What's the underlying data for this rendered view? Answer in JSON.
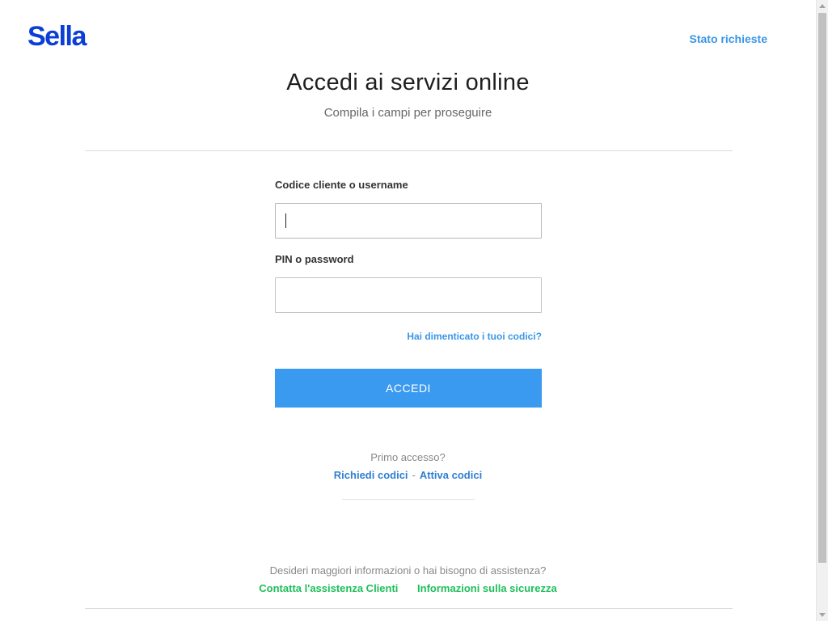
{
  "header": {
    "logo_text": "Sella",
    "status_link": "Stato richieste"
  },
  "main": {
    "title": "Accedi ai servizi online",
    "subtitle": "Compila i campi per proseguire"
  },
  "form": {
    "username_label": "Codice cliente o username",
    "username_value": "",
    "password_label": "PIN o password",
    "password_value": "",
    "forgot_link": "Hai dimenticato i tuoi codici?",
    "submit_label": "ACCEDI"
  },
  "first_access": {
    "question": "Primo accesso?",
    "request_codes": "Richiedi codici",
    "separator": "-",
    "activate_codes": "Attiva codici"
  },
  "help": {
    "question": "Desideri maggiori informazioni o hai bisogno di assistenza?",
    "contact_link": "Contatta l'assistenza Clienti",
    "security_link": "Informazioni sulla sicurezza"
  },
  "colors": {
    "brand": "#0a3ed6",
    "accent": "#3a9af0",
    "link": "#3a96e6",
    "green_link": "#1dbf5a"
  }
}
